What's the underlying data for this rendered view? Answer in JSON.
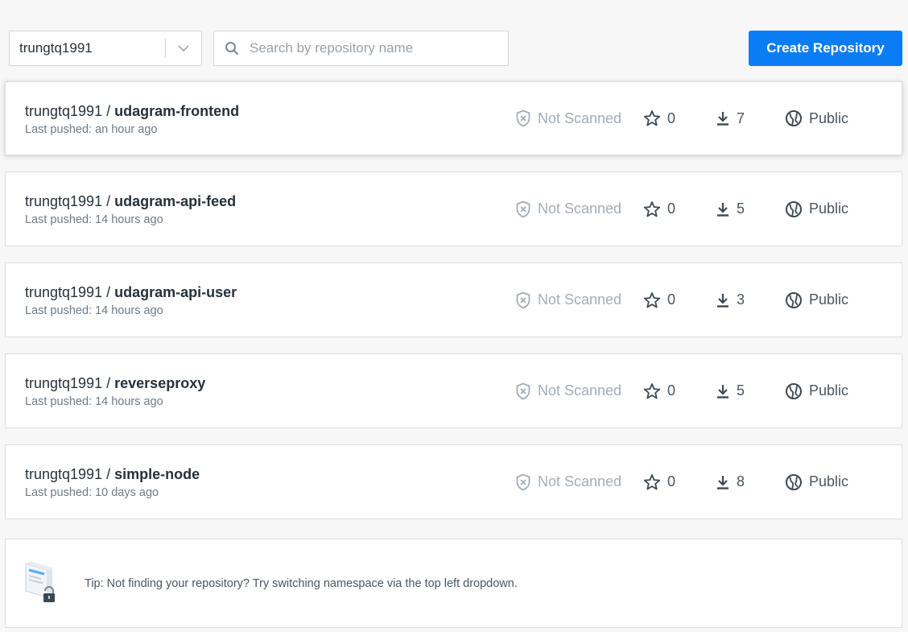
{
  "toolbar": {
    "namespace": "trungtq1991",
    "search_placeholder": "Search by repository name",
    "create_label": "Create Repository"
  },
  "repositories": [
    {
      "namespace": "trungtq1991",
      "separator": "/",
      "name": "udagram-frontend",
      "last_pushed": "Last pushed: an hour ago",
      "scan_status": "Not Scanned",
      "stars": "0",
      "pulls": "7",
      "visibility": "Public"
    },
    {
      "namespace": "trungtq1991",
      "separator": "/",
      "name": "udagram-api-feed",
      "last_pushed": "Last pushed: 14 hours ago",
      "scan_status": "Not Scanned",
      "stars": "0",
      "pulls": "5",
      "visibility": "Public"
    },
    {
      "namespace": "trungtq1991",
      "separator": "/",
      "name": "udagram-api-user",
      "last_pushed": "Last pushed: 14 hours ago",
      "scan_status": "Not Scanned",
      "stars": "0",
      "pulls": "3",
      "visibility": "Public"
    },
    {
      "namespace": "trungtq1991",
      "separator": "/",
      "name": "reverseproxy",
      "last_pushed": "Last pushed: 14 hours ago",
      "scan_status": "Not Scanned",
      "stars": "0",
      "pulls": "5",
      "visibility": "Public"
    },
    {
      "namespace": "trungtq1991",
      "separator": "/",
      "name": "simple-node",
      "last_pushed": "Last pushed: 10 days ago",
      "scan_status": "Not Scanned",
      "stars": "0",
      "pulls": "8",
      "visibility": "Public"
    }
  ],
  "tip": {
    "text": "Tip: Not finding your repository? Try switching namespace via the top left dropdown."
  },
  "icons": {
    "dropdown": "chevron-down-icon",
    "search": "search-icon",
    "scan": "shield-x-icon",
    "stars": "star-icon",
    "pulls": "download-icon",
    "visibility": "globe-icon",
    "tip": "lock-illustration"
  },
  "colors": {
    "accent": "#0b7df4",
    "background": "#f7f7f7",
    "muted": "#a4adb6"
  }
}
